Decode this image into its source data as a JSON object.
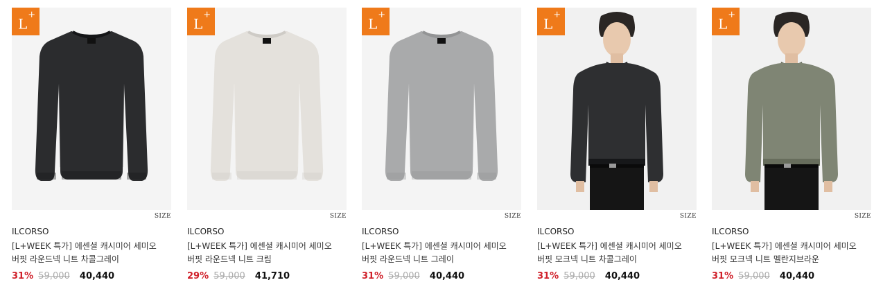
{
  "products": [
    {
      "badge": "L",
      "badge_sup": "+",
      "size_label": "SIZE",
      "brand": "ILCORSO",
      "name_line1": "[L+WEEK 특가] 에센셜 캐시미어 세미오",
      "name_line2": "버핏 라운드넥 니트 차콜그레이",
      "discount_rate": "31%",
      "original_price": "59,000",
      "sale_price": "40,440",
      "image": {
        "type": "flat",
        "color": "#2b2c2e"
      }
    },
    {
      "badge": "L",
      "badge_sup": "+",
      "size_label": "SIZE",
      "brand": "ILCORSO",
      "name_line1": "[L+WEEK 특가] 에센셜 캐시미어 세미오",
      "name_line2": "버핏 라운드넥 니트 크림",
      "discount_rate": "29%",
      "original_price": "59,000",
      "sale_price": "41,710",
      "image": {
        "type": "flat",
        "color": "#e4e1dc"
      }
    },
    {
      "badge": "L",
      "badge_sup": "+",
      "size_label": "SIZE",
      "brand": "ILCORSO",
      "name_line1": "[L+WEEK 특가] 에센셜 캐시미어 세미오",
      "name_line2": "버핏 라운드넥 니트 그레이",
      "discount_rate": "31%",
      "original_price": "59,000",
      "sale_price": "40,440",
      "image": {
        "type": "flat",
        "color": "#a9aaab"
      }
    },
    {
      "badge": "L",
      "badge_sup": "+",
      "size_label": "SIZE",
      "brand": "ILCORSO",
      "name_line1": "[L+WEEK 특가] 에센셜 캐시미어 세미오",
      "name_line2": "버핏 모크넥 니트 차콜그레이",
      "discount_rate": "31%",
      "original_price": "59,000",
      "sale_price": "40,440",
      "image": {
        "type": "model",
        "color": "#2e2f31"
      }
    },
    {
      "badge": "L",
      "badge_sup": "+",
      "size_label": "SIZE",
      "brand": "ILCORSO",
      "name_line1": "[L+WEEK 특가] 에센셜 캐시미어 세미오",
      "name_line2": "버핏 모크넥 니트 멜란지브라운",
      "discount_rate": "31%",
      "original_price": "59,000",
      "sale_price": "40,440",
      "image": {
        "type": "model",
        "color": "#7f8574"
      }
    }
  ],
  "colors": {
    "badge": "#ef7a1a",
    "discount": "#d0202a",
    "original_price": "#aaaaaa"
  }
}
